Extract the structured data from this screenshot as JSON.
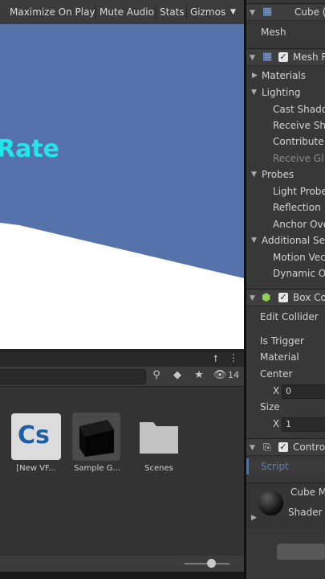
{
  "game_toolbar": {
    "maximize_on_play": "Maximize On Play",
    "mute_audio": "Mute Audio",
    "stats": "Stats",
    "gizmos": "Gizmos"
  },
  "game_view": {
    "overlay_text": "Rate",
    "colors": {
      "sky": "#5672aa",
      "floor": "#ffffff",
      "text": "#21e7e5"
    }
  },
  "project": {
    "hidden_count": "14",
    "assets": [
      {
        "label": "[New VF...",
        "icon": "csharp-script-icon"
      },
      {
        "label": "Sample G...",
        "icon": "black-cube-prefab-icon"
      },
      {
        "label": "Scenes",
        "icon": "folder-icon"
      }
    ],
    "script_badge": "Cs"
  },
  "inspector": {
    "mesh_filter": {
      "title": "Cube (",
      "mesh_label": "Mesh"
    },
    "mesh_renderer": {
      "title": "Mesh R",
      "sections": {
        "materials": "Materials",
        "lighting": "Lighting",
        "cast_shadows": "Cast Shado",
        "receive_shadows": "Receive Sh",
        "contribute_gi": "Contribute",
        "receive_gi": "Receive Gl",
        "probes": "Probes",
        "light_probes": "Light Probe",
        "reflection_probes": "Reflection",
        "anchor_override": "Anchor Ove",
        "additional_settings": "Additional Se",
        "motion_vectors": "Motion Vec",
        "dynamic_occlusion": "Dynamic O"
      }
    },
    "box_collider": {
      "title": "Box Co",
      "edit_collider": "Edit Collider",
      "is_trigger": "Is Trigger",
      "material": "Material",
      "center": "Center",
      "center_x_label": "X",
      "center_x": "0",
      "size": "Size",
      "size_x_label": "X",
      "size_x": "1"
    },
    "script_component": {
      "title": "Contro",
      "script_label": "Script"
    },
    "material": {
      "name": "Cube M",
      "shader": "Shader"
    }
  }
}
